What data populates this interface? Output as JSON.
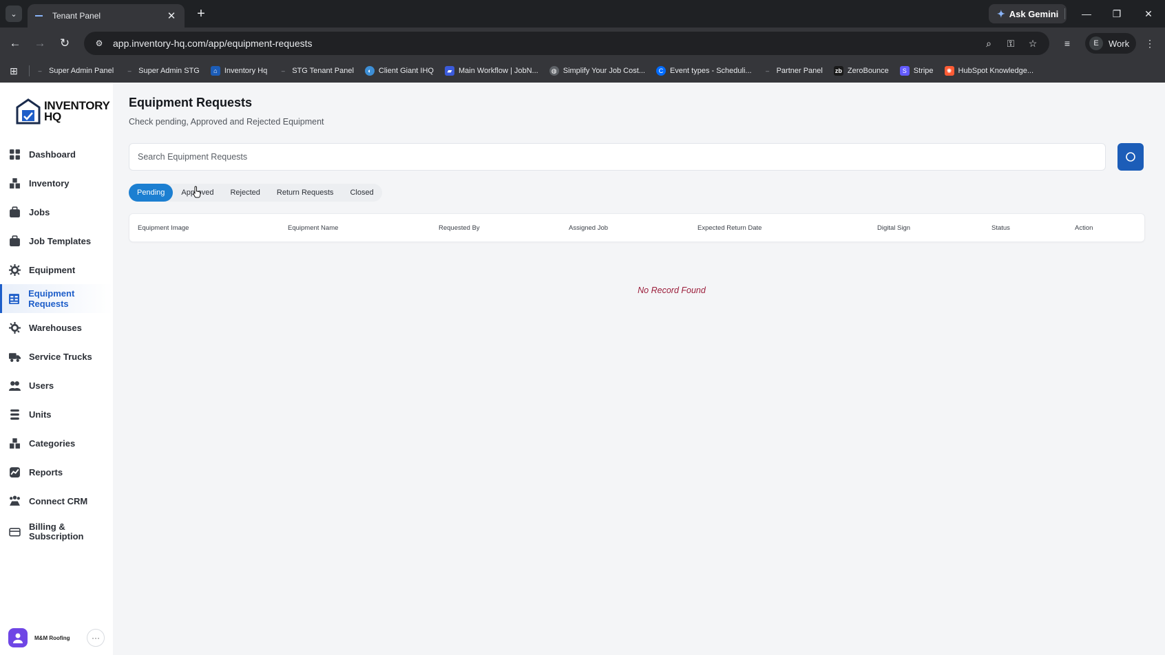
{
  "browser": {
    "tab_title": "Tenant Panel",
    "ask_gemini": "Ask Gemini",
    "url": "app.inventory-hq.com/app/equipment-requests",
    "profile_initial": "E",
    "profile_name": "Work",
    "bookmarks": [
      {
        "label": "Super Admin Panel",
        "icon": "dash-icon"
      },
      {
        "label": "Super Admin STG",
        "icon": "dash-icon"
      },
      {
        "label": "Inventory Hq",
        "icon": "house-icon"
      },
      {
        "label": "STG Tenant Panel",
        "icon": "dash-icon"
      },
      {
        "label": "Client Giant IHQ",
        "icon": "circle-icon"
      },
      {
        "label": "Main Workflow | JobN...",
        "icon": "jobn-icon"
      },
      {
        "label": "Simplify Your Job Cost...",
        "icon": "globe-icon"
      },
      {
        "label": "Event types - Scheduli...",
        "icon": "calendly-icon"
      },
      {
        "label": "Partner Panel",
        "icon": "dash-icon"
      },
      {
        "label": "ZeroBounce",
        "icon": "zb-icon"
      },
      {
        "label": "Stripe",
        "icon": "stripe-icon"
      },
      {
        "label": "HubSpot Knowledge...",
        "icon": "hubspot-icon"
      }
    ]
  },
  "brand": {
    "logo_line1": "INVENTORY",
    "logo_line2": "HQ",
    "accent": "#1e5ec9"
  },
  "sidebar": {
    "items": [
      {
        "label": "Dashboard",
        "icon": "dashboard-icon"
      },
      {
        "label": "Inventory",
        "icon": "inventory-icon"
      },
      {
        "label": "Jobs",
        "icon": "jobs-icon"
      },
      {
        "label": "Job Templates",
        "icon": "job-templates-icon"
      },
      {
        "label": "Equipment",
        "icon": "equipment-icon"
      },
      {
        "label": "Equipment Requests",
        "icon": "equipment-requests-icon",
        "active": true
      },
      {
        "label": "Warehouses",
        "icon": "warehouses-icon"
      },
      {
        "label": "Service Trucks",
        "icon": "truck-icon"
      },
      {
        "label": "Users",
        "icon": "users-icon"
      },
      {
        "label": "Units",
        "icon": "units-icon"
      },
      {
        "label": "Categories",
        "icon": "categories-icon"
      },
      {
        "label": "Reports",
        "icon": "reports-icon"
      },
      {
        "label": "Connect CRM",
        "icon": "crm-icon"
      },
      {
        "label": "Billing & Subscription",
        "icon": "billing-icon"
      }
    ],
    "user_name": "M&M Roofing",
    "more": "···"
  },
  "page": {
    "title": "Equipment Requests",
    "subtitle": "Check pending, Approved and Rejected Equipment",
    "search_placeholder": "Search Equipment Requests",
    "tabs": [
      "Pending",
      "Approved",
      "Rejected",
      "Return Requests",
      "Closed"
    ],
    "active_tab": "Pending",
    "columns": [
      "Equipment Image",
      "Equipment Name",
      "Requested By",
      "Assigned Job",
      "Expected Return Date",
      "Digital Sign",
      "Status",
      "Action"
    ],
    "empty_text": "No Record Found"
  }
}
